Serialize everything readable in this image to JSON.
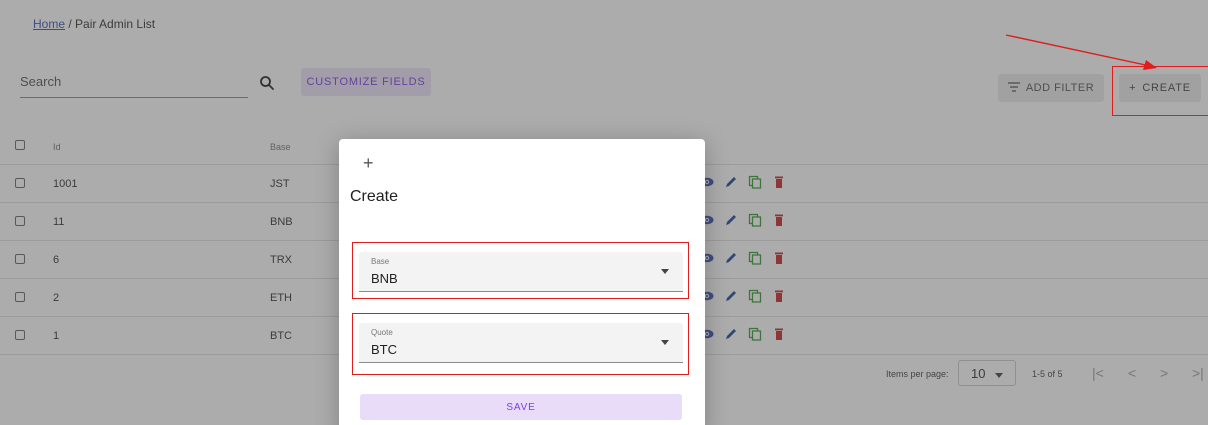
{
  "breadcrumb": {
    "home": "Home",
    "separator": " / ",
    "current": "Pair Admin List"
  },
  "search": {
    "placeholder": "Search",
    "value": ""
  },
  "toolbar": {
    "customize_label": "CUSTOMIZE FIELDS",
    "add_filter_label": "ADD FILTER",
    "create_label": "CREATE",
    "create_prefix": "+"
  },
  "table": {
    "columns": [
      "Id",
      "Base"
    ],
    "rows": [
      {
        "id": "1001",
        "base": "JST"
      },
      {
        "id": "11",
        "base": "BNB"
      },
      {
        "id": "6",
        "base": "TRX"
      },
      {
        "id": "2",
        "base": "ETH"
      },
      {
        "id": "1",
        "base": "BTC"
      }
    ],
    "row_actions": [
      "view-icon",
      "edit-icon",
      "copy-icon",
      "delete-icon"
    ]
  },
  "pagination": {
    "items_per_page_label": "Items per page:",
    "items_per_page": "10",
    "range": "1-5 of 5"
  },
  "dialog": {
    "icon": "+",
    "title": "Create",
    "fields": [
      {
        "label": "Base",
        "value": "BNB"
      },
      {
        "label": "Quote",
        "value": "BTC"
      }
    ],
    "save_label": "SAVE"
  },
  "colors": {
    "accent": "#7b3fe4",
    "accent_bg": "#eee3fb",
    "highlight": "#e01d1d",
    "view": "#3f51b5",
    "edit": "#1e4a9c",
    "copy": "#3a9a3a",
    "delete": "#c62828"
  }
}
